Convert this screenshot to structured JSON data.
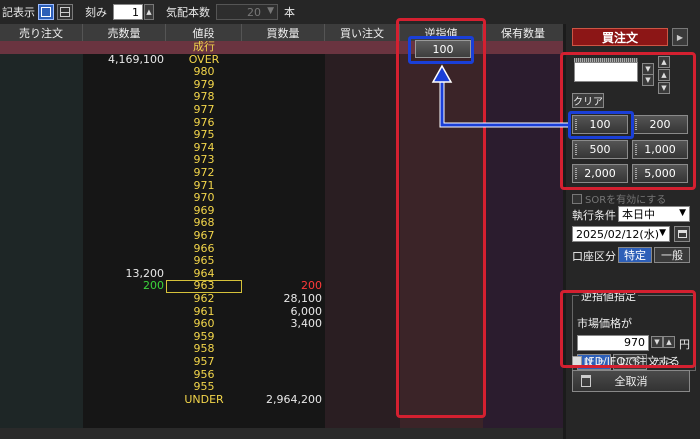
{
  "toolbar": {
    "display_label": "記表示",
    "tick_label": "刻み",
    "tick_value": "1",
    "quote_count_label": "気配本数",
    "quote_count_value": "20",
    "quote_count_unit": "本"
  },
  "board": {
    "headers": [
      "売り注文",
      "売数量",
      "値段",
      "買数量",
      "買い注文",
      "逆指値",
      "保有数量"
    ],
    "stop_button_label": "100",
    "rows": [
      {
        "sell_qty": "",
        "price": "成行",
        "buy_qty": ""
      },
      {
        "sell_qty": "4,169,100",
        "price": "OVER",
        "buy_qty": ""
      },
      {
        "sell_qty": "",
        "price": "980",
        "buy_qty": ""
      },
      {
        "sell_qty": "",
        "price": "979",
        "buy_qty": ""
      },
      {
        "sell_qty": "",
        "price": "978",
        "buy_qty": ""
      },
      {
        "sell_qty": "",
        "price": "977",
        "buy_qty": ""
      },
      {
        "sell_qty": "",
        "price": "976",
        "buy_qty": ""
      },
      {
        "sell_qty": "",
        "price": "975",
        "buy_qty": ""
      },
      {
        "sell_qty": "",
        "price": "974",
        "buy_qty": ""
      },
      {
        "sell_qty": "",
        "price": "973",
        "buy_qty": ""
      },
      {
        "sell_qty": "",
        "price": "972",
        "buy_qty": ""
      },
      {
        "sell_qty": "",
        "price": "971",
        "buy_qty": ""
      },
      {
        "sell_qty": "",
        "price": "970",
        "buy_qty": ""
      },
      {
        "sell_qty": "",
        "price": "969",
        "buy_qty": ""
      },
      {
        "sell_qty": "",
        "price": "968",
        "buy_qty": ""
      },
      {
        "sell_qty": "",
        "price": "967",
        "buy_qty": ""
      },
      {
        "sell_qty": "",
        "price": "966",
        "buy_qty": ""
      },
      {
        "sell_qty": "",
        "price": "965",
        "buy_qty": ""
      },
      {
        "sell_qty": "13,200",
        "price": "964",
        "buy_qty": ""
      },
      {
        "sell_qty": "200",
        "price": "963",
        "buy_qty": "200"
      },
      {
        "sell_qty": "",
        "price": "962",
        "buy_qty": "28,100"
      },
      {
        "sell_qty": "",
        "price": "961",
        "buy_qty": "6,000"
      },
      {
        "sell_qty": "",
        "price": "960",
        "buy_qty": "3,400"
      },
      {
        "sell_qty": "",
        "price": "959",
        "buy_qty": ""
      },
      {
        "sell_qty": "",
        "price": "958",
        "buy_qty": ""
      },
      {
        "sell_qty": "",
        "price": "957",
        "buy_qty": ""
      },
      {
        "sell_qty": "",
        "price": "956",
        "buy_qty": ""
      },
      {
        "sell_qty": "",
        "price": "955",
        "buy_qty": ""
      },
      {
        "sell_qty": "",
        "price": "UNDER",
        "buy_qty": "2,964,200"
      }
    ]
  },
  "panel": {
    "buy_order_label": "買注文",
    "clear_label": "クリア",
    "quantity_buttons": [
      "100",
      "200",
      "500",
      "1,000",
      "2,000",
      "5,000"
    ],
    "sor_label": "SORを有効にする",
    "exec_condition_label": "執行条件",
    "exec_condition_value": "本日中",
    "date_value": "2025/02/12(水)",
    "account_label": "口座区分",
    "account_options": [
      "特定",
      "一般"
    ],
    "stop_title": "逆指値指定",
    "market_price_label": "市場価格が",
    "trigger_price": "970",
    "yen_label": "円",
    "above_label": "以上",
    "below_label": "以下",
    "nara_label": "なら",
    "ifd_label": "IFD/IFOで注文する",
    "cancel_all_label": "全取消"
  },
  "colors": {
    "highlight_red": "#d42030",
    "highlight_blue": "#1a3fd8",
    "price_yellow": "#f2d54a",
    "sell_qty_green": "#3ad23a",
    "buy_qty_red": "#ff3a3a",
    "buy_button": "#8c1616"
  }
}
